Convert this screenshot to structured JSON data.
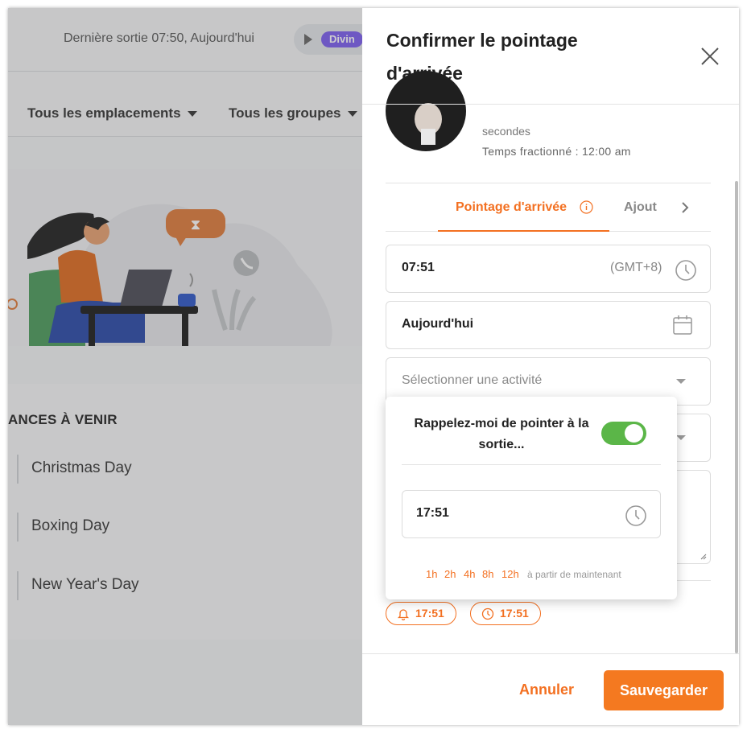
{
  "background": {
    "last_exit": "Dernière sortie 07:50, Aujourd'hui",
    "badge": "Divin",
    "filters": [
      "Tous les emplacements",
      "Tous les groupes"
    ],
    "holidays_title": "ANCES À VENIR",
    "holidays": [
      "Christmas Day",
      "Boxing Day",
      "New Year's Day"
    ]
  },
  "drawer": {
    "title": "Confirmer le pointage d'arrivée",
    "meta_line1": "secondes",
    "meta_line2": "Temps fractionné : 12:00 am",
    "tab_active": "Pointage d'arrivée",
    "tab_next": "Ajout",
    "time_value": "07:51",
    "timezone": "(GMT+8)",
    "date_value": "Aujourd'hui",
    "activity_placeholder": "Sélectionner une activité",
    "chips": [
      "17:51",
      "17:51"
    ],
    "cancel_label": "Annuler",
    "save_label": "Sauvegarder"
  },
  "popover": {
    "reminder_text": "Rappelez-moi de pointer à la sortie...",
    "toggle_on": true,
    "time_value": "17:51",
    "quick_options": [
      "1h",
      "2h",
      "4h",
      "8h",
      "12h"
    ],
    "quick_suffix": "à partir de maintenant"
  },
  "colors": {
    "accent": "#f37021",
    "toggle_on": "#5bb648",
    "badge": "#7b5cf0"
  }
}
